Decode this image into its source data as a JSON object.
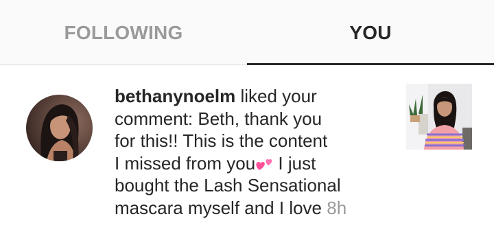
{
  "tabs": {
    "following_label": "FOLLOWING",
    "you_label": "YOU"
  },
  "notification": {
    "username": "bethanynoelm",
    "line1_rest": " liked your",
    "line2": "comment: Beth, thank you",
    "line3": "for this!! This is the content",
    "line4_before_emoji": "I missed from you",
    "line4_after_emoji": " I just",
    "line5": "bought the Lash Sensational",
    "line6": "mascara myself and I love ",
    "timestamp": "8h",
    "emoji": "two-hearts-icon"
  },
  "colors": {
    "tab_active": "#262626",
    "tab_inactive": "#9a9a9a",
    "text": "#262626",
    "timestamp": "#9a9a9a",
    "heart": "#ff4f9a"
  }
}
